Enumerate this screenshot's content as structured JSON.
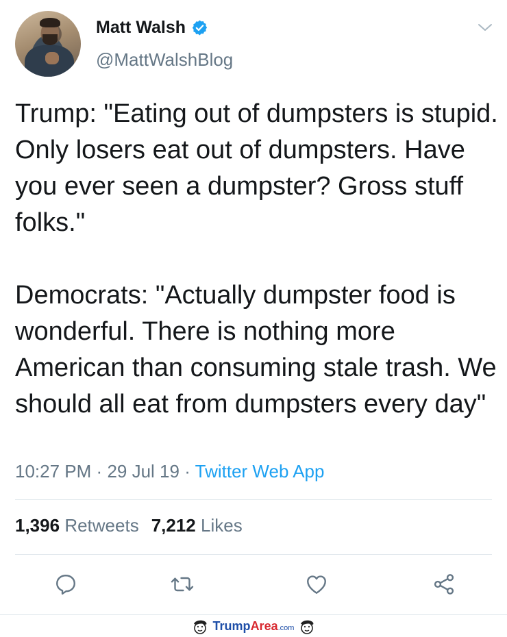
{
  "author": {
    "display_name": "Matt Walsh",
    "handle": "@MattWalshBlog",
    "verified_icon": "verified-badge-icon"
  },
  "tweet": {
    "paragraphs": [
      "Trump: \"Eating out of dumpsters is stupid. Only losers eat out of dumpsters. Have you ever seen a dumpster? Gross stuff folks.\"",
      "Democrats: \"Actually dumpster food is wonderful. There is nothing more American than consuming stale trash. We should all eat from dumpsters every day\""
    ],
    "time": "10:27 PM",
    "sep": "·",
    "date": "29 Jul 19",
    "source": "Twitter Web App"
  },
  "stats": {
    "retweets_count": "1,396",
    "retweets_label": "Retweets",
    "likes_count": "7,212",
    "likes_label": "Likes"
  },
  "actions": {
    "reply_icon": "reply-icon",
    "retweet_icon": "retweet-icon",
    "like_icon": "heart-icon",
    "share_icon": "share-icon"
  },
  "watermark": {
    "part1": "Trump",
    "part2": "Area",
    "part3": ".com"
  },
  "colors": {
    "accent": "#1da1f2",
    "secondary_text": "#657786",
    "primary_text": "#14171a"
  }
}
